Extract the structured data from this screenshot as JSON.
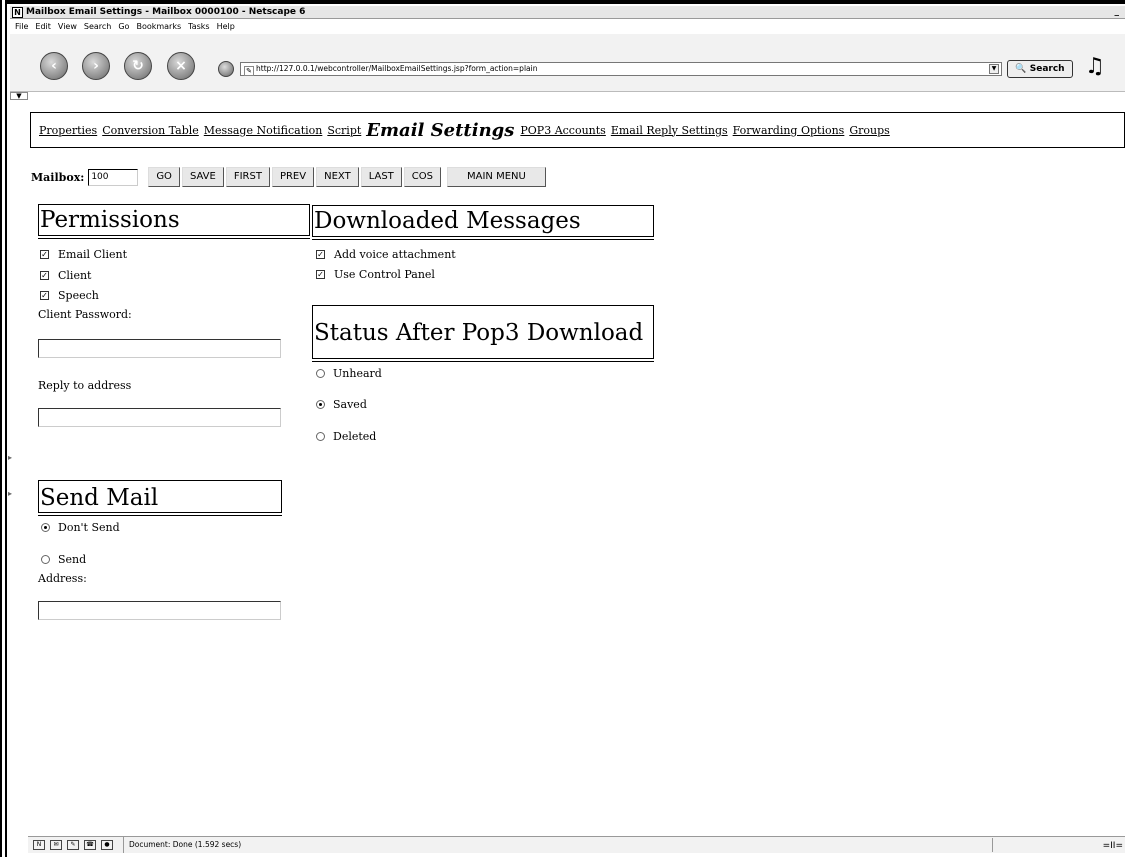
{
  "window": {
    "title": "Mailbox Email Settings - Mailbox 0000100 - Netscape 6",
    "app_icon": "N",
    "minimize": "_"
  },
  "menu": [
    "File",
    "Edit",
    "View",
    "Search",
    "Go",
    "Bookmarks",
    "Tasks",
    "Help"
  ],
  "toolbar": {
    "url": "http://127.0.0.1/webcontroller/MailboxEmailSettings.jsp?form_action=plain",
    "search_label": "Search",
    "icons": [
      "back-icon",
      "forward-icon",
      "reload-icon",
      "stop-icon",
      "home-icon"
    ]
  },
  "tabs": {
    "items": [
      "Properties",
      "Conversion Table",
      "Message Notification",
      "Script"
    ],
    "current": "Email Settings",
    "items_after": [
      "POP3 Accounts",
      "Email Reply Settings",
      "Forwarding Options",
      "Groups"
    ]
  },
  "mailbox": {
    "label": "Mailbox:",
    "value": "100",
    "buttons": [
      "GO",
      "SAVE",
      "FIRST",
      "PREV",
      "NEXT",
      "LAST",
      "COS"
    ],
    "main_menu": "MAIN MENU"
  },
  "permissions": {
    "title": "Permissions",
    "items": [
      {
        "label": "Email Client",
        "checked": true
      },
      {
        "label": "Client",
        "checked": true
      },
      {
        "label": "Speech",
        "checked": true
      }
    ],
    "client_password_label": "Client Password:",
    "reply_to_label": "Reply to address"
  },
  "downloaded": {
    "title": "Downloaded Messages",
    "items": [
      {
        "label": "Add voice attachment",
        "checked": true
      },
      {
        "label": "Use Control Panel",
        "checked": true
      }
    ]
  },
  "status_after": {
    "title": "Status After Pop3 Download",
    "options": [
      {
        "label": "Unheard",
        "selected": false
      },
      {
        "label": "Saved",
        "selected": true
      },
      {
        "label": "Deleted",
        "selected": false
      }
    ]
  },
  "send_mail": {
    "title": "Send Mail",
    "options": [
      {
        "label": "Don't Send",
        "selected": true
      },
      {
        "label": "Send",
        "selected": false
      }
    ],
    "address_label": "Address:"
  },
  "statusbar": {
    "text": "Document: Done (1.592 secs)",
    "right_icon": "=II="
  }
}
